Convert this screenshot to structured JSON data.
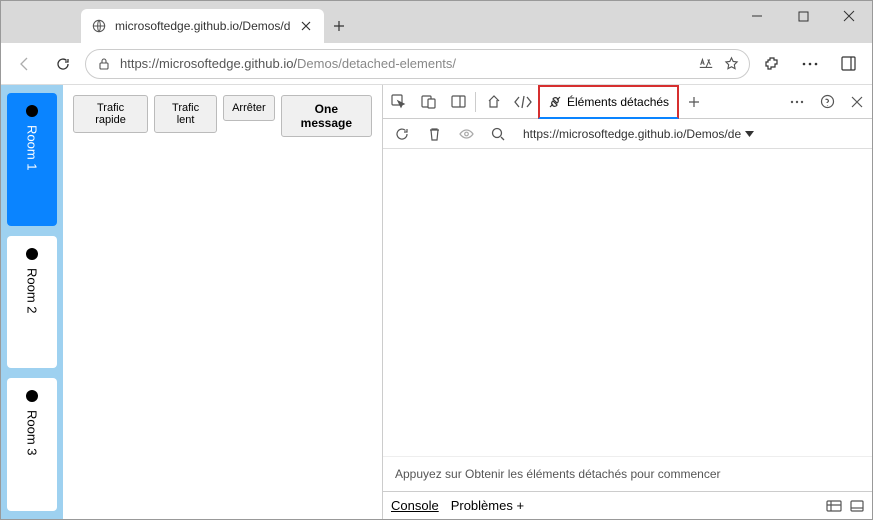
{
  "browser": {
    "tab_title": "microsoftedge.github.io/Demos/d",
    "url_prefix": "https://microsoftedge.github.io/",
    "url_suffix": "Demos/detached-elements/"
  },
  "page": {
    "rooms": [
      {
        "label": "Room 1",
        "active": true
      },
      {
        "label": "Room 2",
        "active": false
      },
      {
        "label": "Room 3",
        "active": false
      }
    ],
    "buttons": {
      "fast": "Trafic rapide",
      "slow": "Trafic lent",
      "stop": "Arrêter",
      "one": "One message"
    }
  },
  "devtools": {
    "active_tab": "Éléments détachés",
    "frame_url": "https://microsoftedge.github.io/Demos/de",
    "hint": "Appuyez sur Obtenir les éléments détachés pour commencer",
    "drawer": {
      "console": "Console",
      "problems": "Problèmes",
      "plus": "+"
    }
  }
}
